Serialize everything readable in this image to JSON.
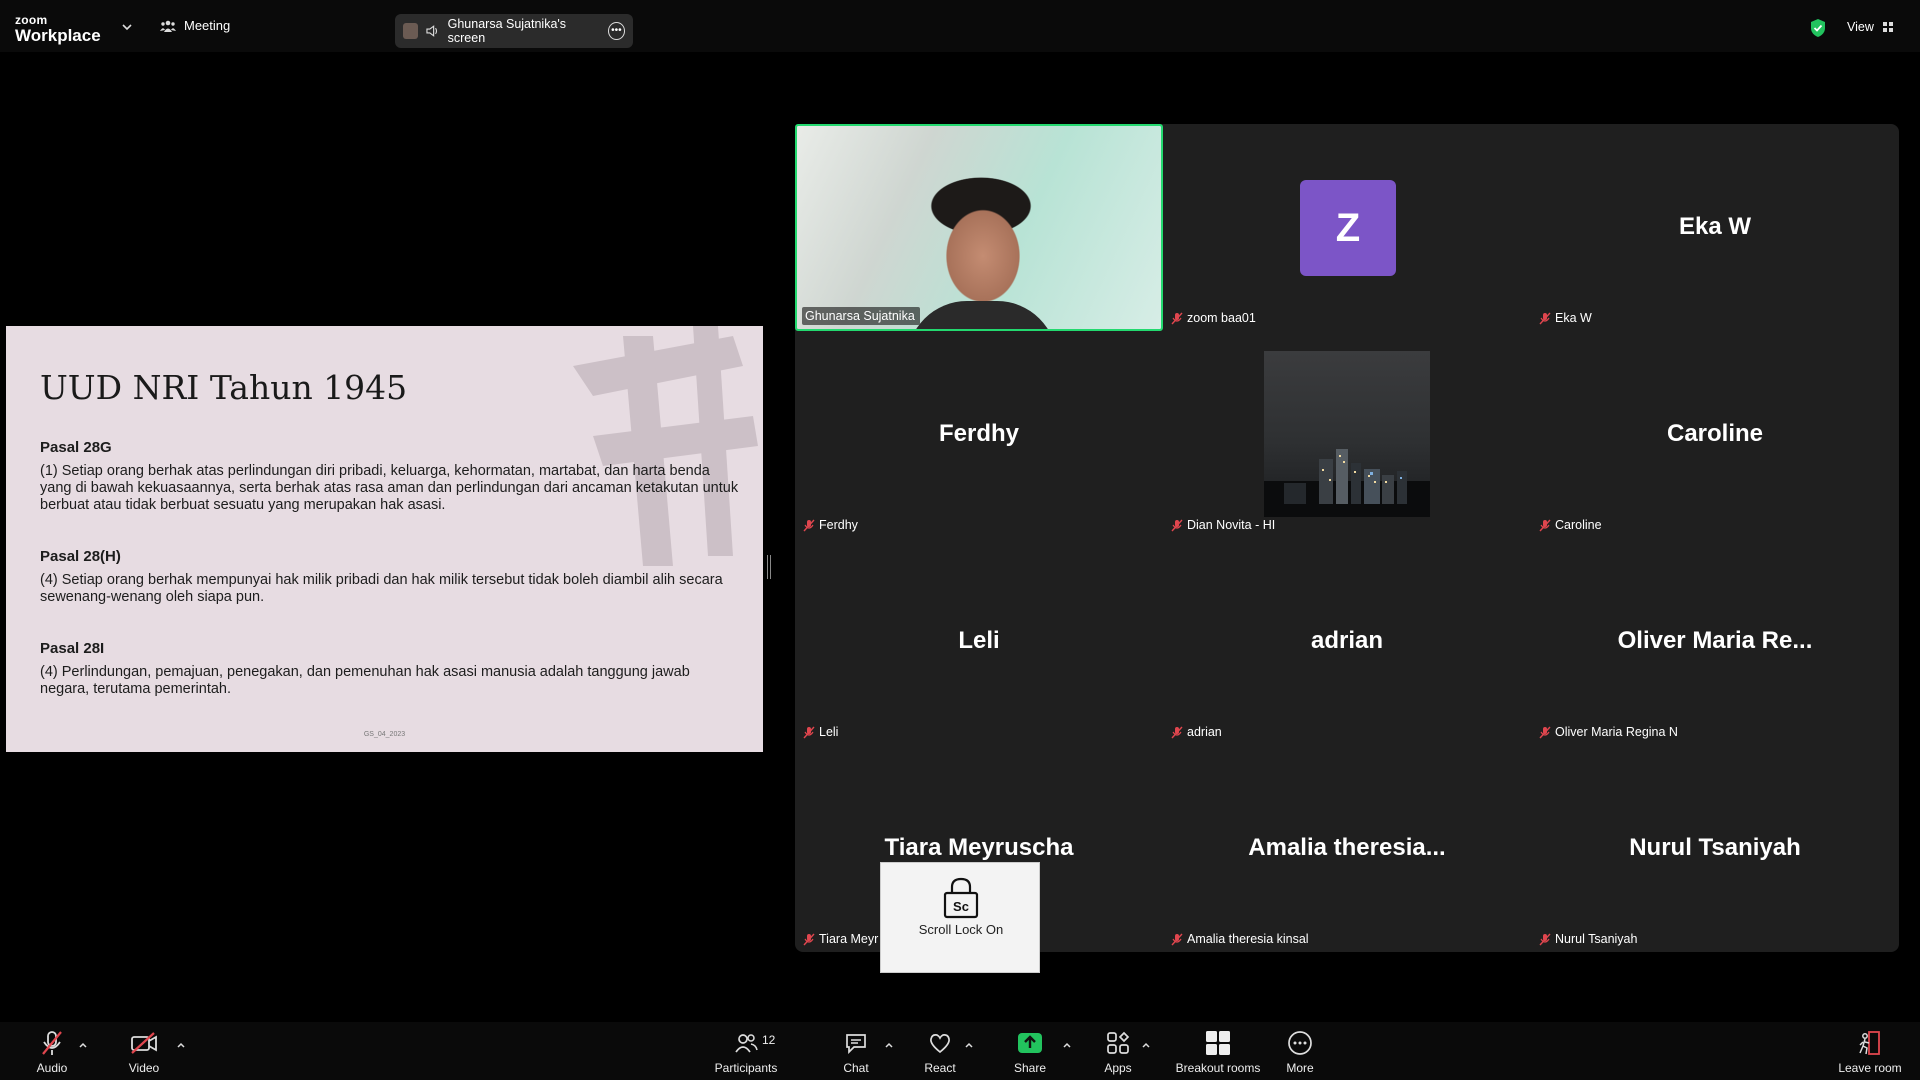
{
  "top_bar": {
    "logo_line1": "zoom",
    "logo_line2": "Workplace",
    "meeting_label": "Meeting",
    "screen_share_label": "Ghunarsa Sujatnika's screen",
    "view_label": "View"
  },
  "slide": {
    "title": "UUD NRI Tahun 1945",
    "sections": [
      {
        "heading": "Pasal 28G",
        "text": "(1) Setiap orang berhak atas perlindungan diri pribadi, keluarga, kehormatan, martabat, dan harta benda yang di bawah kekuasaannya, serta berhak atas rasa aman dan perlindungan dari ancaman ketakutan untuk berbuat atau tidak berbuat sesuatu yang merupakan hak asasi."
      },
      {
        "heading": "Pasal 28(H)",
        "text": "(4) Setiap orang berhak mempunyai hak milik pribadi dan hak milik tersebut tidak boleh diambil alih secara sewenang-wenang oleh siapa pun."
      },
      {
        "heading": "Pasal 28I",
        "text": "(4) Perlindungan, pemajuan, penegakan, dan pemenuhan hak asasi manusia adalah tanggung jawab negara, terutama pemerintah."
      }
    ],
    "footer": "GS_04_2023"
  },
  "participants": [
    {
      "name": "Ghunarsa Sujatnika",
      "display": "",
      "type": "video",
      "muted": false
    },
    {
      "name": "zoom baa01",
      "display": "Z",
      "type": "avatar",
      "muted": true
    },
    {
      "name": "Eka W",
      "display": "Eka W",
      "type": "name",
      "muted": true
    },
    {
      "name": "Ferdhy",
      "display": "Ferdhy",
      "type": "name",
      "muted": true
    },
    {
      "name": "Dian Novita - HI",
      "display": "",
      "type": "photo",
      "muted": true
    },
    {
      "name": "Caroline",
      "display": "Caroline",
      "type": "name",
      "muted": true
    },
    {
      "name": "Leli",
      "display": "Leli",
      "type": "name",
      "muted": true
    },
    {
      "name": "adrian",
      "display": "adrian",
      "type": "name",
      "muted": true
    },
    {
      "name": "Oliver Maria Regina N",
      "display": "Oliver Maria Re...",
      "type": "name",
      "muted": true
    },
    {
      "name": "Tiara Meyr",
      "display": "Tiara Meyruscha",
      "type": "name",
      "muted": true
    },
    {
      "name": "Amalia theresia kinsal",
      "display": "Amalia theresia...",
      "type": "name",
      "muted": true
    },
    {
      "name": "Nurul Tsaniyah",
      "display": "Nurul Tsaniyah",
      "type": "name",
      "muted": true
    }
  ],
  "scroll_lock": {
    "key": "Sc",
    "label": "Scroll Lock On"
  },
  "toolbar": {
    "audio": "Audio",
    "video": "Video",
    "participants": "Participants",
    "participants_count": "12",
    "chat": "Chat",
    "react": "React",
    "share": "Share",
    "apps": "Apps",
    "breakout": "Breakout rooms",
    "more": "More",
    "leave": "Leave room"
  },
  "colors": {
    "active_speaker": "#23d96f",
    "avatar_bg": "#7c55c7",
    "share_green": "#22c35e",
    "muted_red": "#e0464e",
    "leave_red": "#e0464e"
  }
}
